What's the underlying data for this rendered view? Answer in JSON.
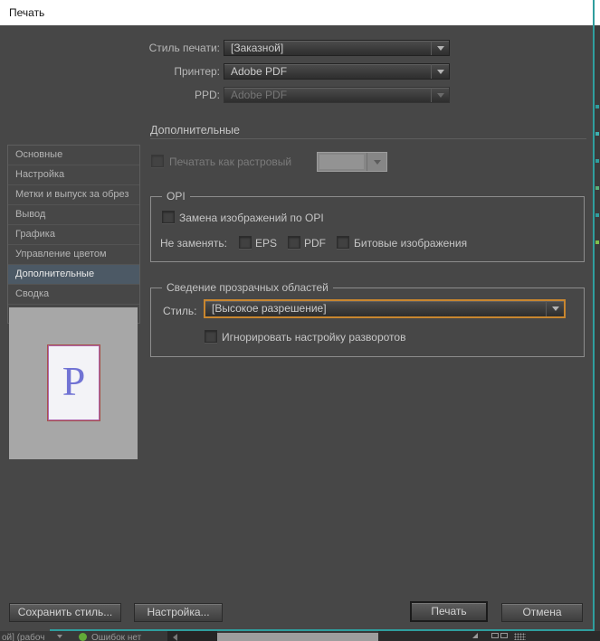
{
  "window": {
    "title": "Печать"
  },
  "top_fields": [
    {
      "label": "Стиль печати:",
      "value": "[Заказной]",
      "disabled": false
    },
    {
      "label": "Принтер:",
      "value": "Adobe PDF",
      "disabled": false
    },
    {
      "label": "PPD:",
      "value": "Adobe PDF",
      "disabled": true
    }
  ],
  "sidebar": {
    "items": [
      "Основные",
      "Настройка",
      "Метки и выпуск за обрез",
      "Вывод",
      "Графика",
      "Управление цветом",
      "Дополнительные",
      "Сводка"
    ],
    "selected": "Дополнительные"
  },
  "panel": {
    "title": "Дополнительные",
    "raster_checkbox_label": "Печатать как растровый",
    "opi_group": {
      "title": "OPI",
      "replace_checkbox_label": "Замена изображений по OPI",
      "no_replace_label": "Не заменять:",
      "options": [
        "EPS",
        "PDF",
        "Битовые изображения"
      ]
    },
    "flatten_group": {
      "title": "Сведение прозрачных областей",
      "style_label": "Стиль:",
      "style_value": "[Высокое разрешение]",
      "ignore_checkbox_label": "Игнорировать настройку разворотов"
    }
  },
  "preview": {
    "letter": "P"
  },
  "buttons": {
    "save_style": "Сохранить стиль...",
    "setup": "Настройка...",
    "print": "Печать",
    "cancel": "Отмена"
  },
  "statusbar": {
    "left_text": "ой] (рабоч",
    "status_text": "Ошибок нет"
  },
  "colors": {
    "dialog_bg": "#474747",
    "accent_orange": "#c8862f",
    "sidebar_selected": "#4c5965",
    "window_frame_teal": "#2f9e9e",
    "status_green": "#62aa38",
    "preview_letter": "#7173d4",
    "page_border_outer": "#a8524a",
    "page_border_inner": "#af66af"
  }
}
